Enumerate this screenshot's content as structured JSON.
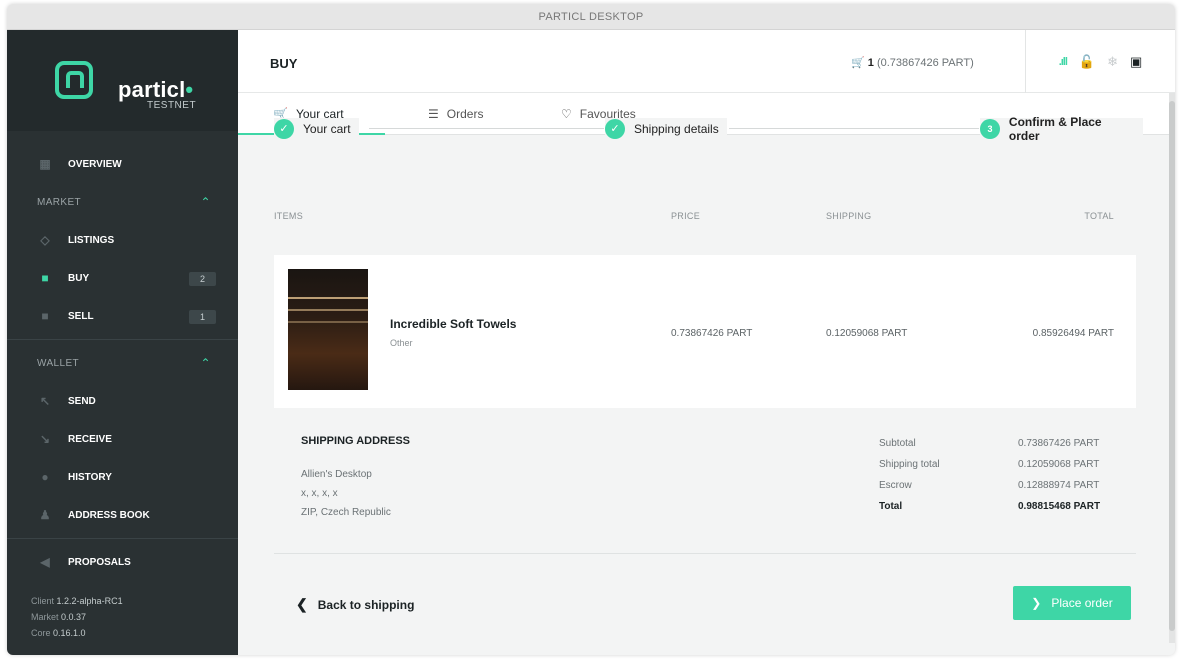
{
  "window": {
    "title": "PARTICL DESKTOP"
  },
  "logo": {
    "name": "particl",
    "dot": "•",
    "subtitle": "TESTNET"
  },
  "sidebar": {
    "overview": "OVERVIEW",
    "market_section": "MARKET",
    "listings": "LISTINGS",
    "buy": "BUY",
    "buy_badge": "2",
    "sell": "SELL",
    "sell_badge": "1",
    "wallet_section": "WALLET",
    "send": "SEND",
    "receive": "RECEIVE",
    "history": "HISTORY",
    "address_book": "ADDRESS BOOK",
    "proposals": "PROPOSALS",
    "chevron": "⌃"
  },
  "versions": {
    "client_label": "Client",
    "client": "1.2.2-alpha-RC1",
    "market_label": "Market",
    "market": "0.0.37",
    "core_label": "Core",
    "core": "0.16.1.0"
  },
  "header": {
    "title": "BUY",
    "cart_count": "1",
    "cart_amount": "(0.73867426 PART)"
  },
  "tabs": {
    "cart": "Your cart",
    "orders": "Orders",
    "favourites": "Favourites"
  },
  "steps": {
    "step1": "Your cart",
    "step2": "Shipping details",
    "step3_num": "3",
    "step3": "Confirm & Place order"
  },
  "table": {
    "col_items": "ITEMS",
    "col_price": "PRICE",
    "col_shipping": "SHIPPING",
    "col_total": "TOTAL",
    "item": {
      "name": "Incredible Soft Towels",
      "category": "Other",
      "price": "0.73867426 PART",
      "shipping": "0.12059068 PART",
      "total": "0.85926494 PART"
    }
  },
  "shipping_address": {
    "heading": "SHIPPING ADDRESS",
    "line1": "Allien's Desktop",
    "line2": "x, x, x, x",
    "line3": "ZIP, Czech Republic"
  },
  "totals": {
    "subtotal_label": "Subtotal",
    "subtotal": "0.73867426 PART",
    "shipping_label": "Shipping total",
    "shipping": "0.12059068 PART",
    "escrow_label": "Escrow",
    "escrow": "0.12888974 PART",
    "total_label": "Total",
    "total": "0.98815468 PART"
  },
  "actions": {
    "back": "Back to shipping",
    "place_order": "Place order"
  },
  "colors": {
    "accent": "#3ed6a6",
    "sidebar": "#2a3133"
  }
}
